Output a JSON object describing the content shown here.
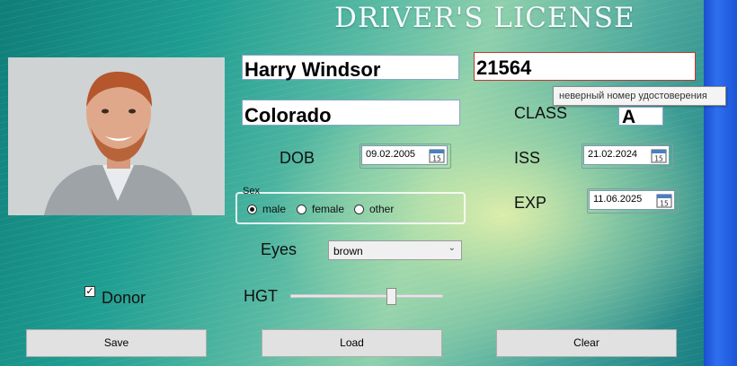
{
  "title": "DRIVER'S LICENSE",
  "name_value": "Harry Windsor",
  "license_no_value": "21564",
  "tooltip": "неверный номер удостоверения",
  "state_value": "Colorado",
  "class_label": "CLASS",
  "class_value": "A",
  "dob_label": "DOB",
  "dob_value": "09.02.2005",
  "iss_label": "ISS",
  "iss_value": "21.02.2024",
  "exp_label": "EXP",
  "exp_value": "11.06.2025",
  "sex": {
    "label": "Sex",
    "options": [
      "male",
      "female",
      "other"
    ],
    "selected": "male"
  },
  "eyes_label": "Eyes",
  "eyes_value": "brown",
  "donor_label": "Donor",
  "donor_checked": true,
  "hgt_label": "HGT",
  "hgt_level": 0.67,
  "buttons": {
    "save": "Save",
    "load": "Load",
    "clear": "Clear"
  }
}
